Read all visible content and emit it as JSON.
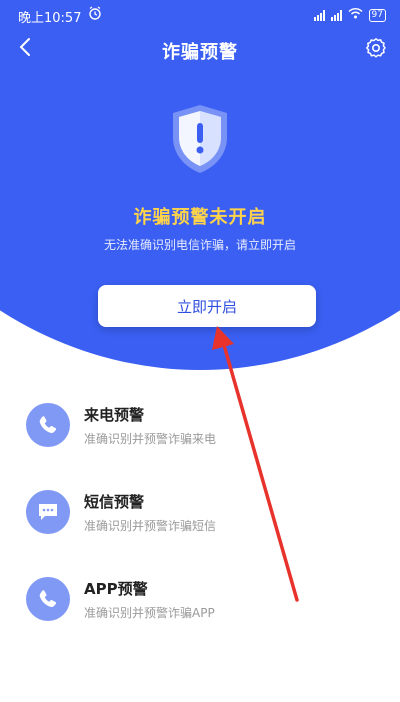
{
  "status_bar": {
    "time": "晚上10:57",
    "battery": "97"
  },
  "nav": {
    "title": "诈骗预警"
  },
  "hero": {
    "status_title": "诈骗预警未开启",
    "status_subtitle": "无法准确识别电信诈骗，请立即开启",
    "enable_button": "立即开启"
  },
  "features": [
    {
      "name": "来电预警",
      "desc": "准确识别并预警诈骗来电",
      "icon": "phone-icon"
    },
    {
      "name": "短信预警",
      "desc": "准确识别并预警诈骗短信",
      "icon": "message-icon"
    },
    {
      "name": "APP预警",
      "desc": "准确识别并预警诈骗APP",
      "icon": "phone-icon"
    }
  ],
  "colors": {
    "primary": "#3a5ff2",
    "warning": "#ffd34a",
    "icon_bg": "#7f99f5",
    "annotation": "#e8322c"
  }
}
